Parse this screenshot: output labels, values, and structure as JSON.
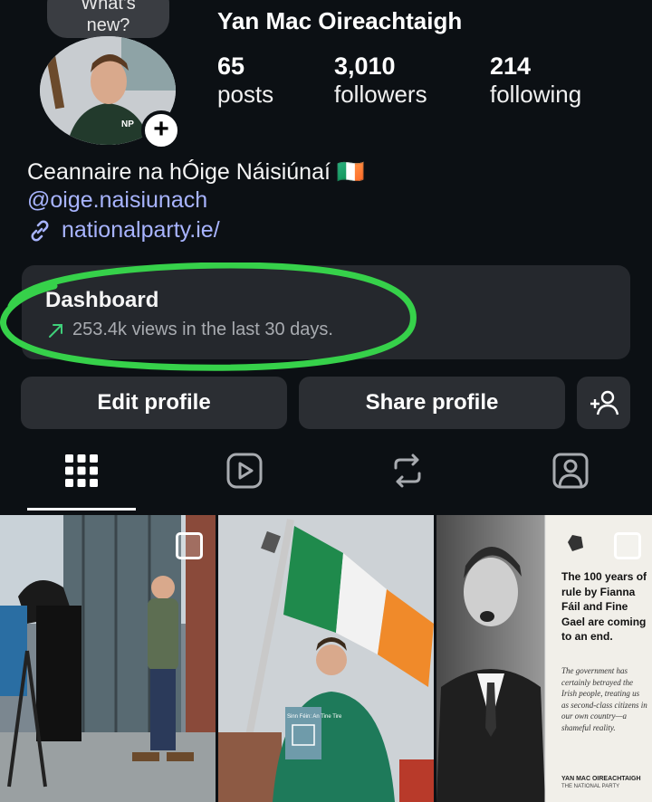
{
  "profile": {
    "note": "What's\nnew?",
    "username": "Yan Mac Oireachtaigh",
    "stats": [
      {
        "num": "65",
        "label": "posts"
      },
      {
        "num": "3,010",
        "label": "followers"
      },
      {
        "num": "214",
        "label": "following"
      }
    ],
    "bio": "Ceannaire na hÓige Náisiúnaí 🇮🇪",
    "handle": "@oige.naisiunach",
    "link": "nationalparty.ie/"
  },
  "dashboard": {
    "title": "Dashboard",
    "subtitle": "253.4k views in the last 30 days."
  },
  "buttons": {
    "edit": "Edit profile",
    "share": "Share profile"
  },
  "tabs": [
    "grid-tab",
    "reels-tab",
    "reposts-tab",
    "tagged-tab"
  ],
  "posts": {
    "flag_book_title": "Sinn Féin: An Tine Tire",
    "shirt_logo": "NP",
    "card": {
      "headline": "The 100 years of rule by Fianna Fáil and Fine Gael are coming to an end.",
      "body": "The government has certainly betrayed the Irish people, treating us as second-class citizens in our own country—a shameful reality.",
      "sig_name": "YAN MAC OIREACHTAIGH",
      "sig_party": "THE NATIONAL PARTY"
    }
  },
  "colors": {
    "background": "#0c1014",
    "panel": "#25282d",
    "button": "#2b2e33",
    "link": "#a8b4ff",
    "highlight_green": "#36d14a"
  }
}
